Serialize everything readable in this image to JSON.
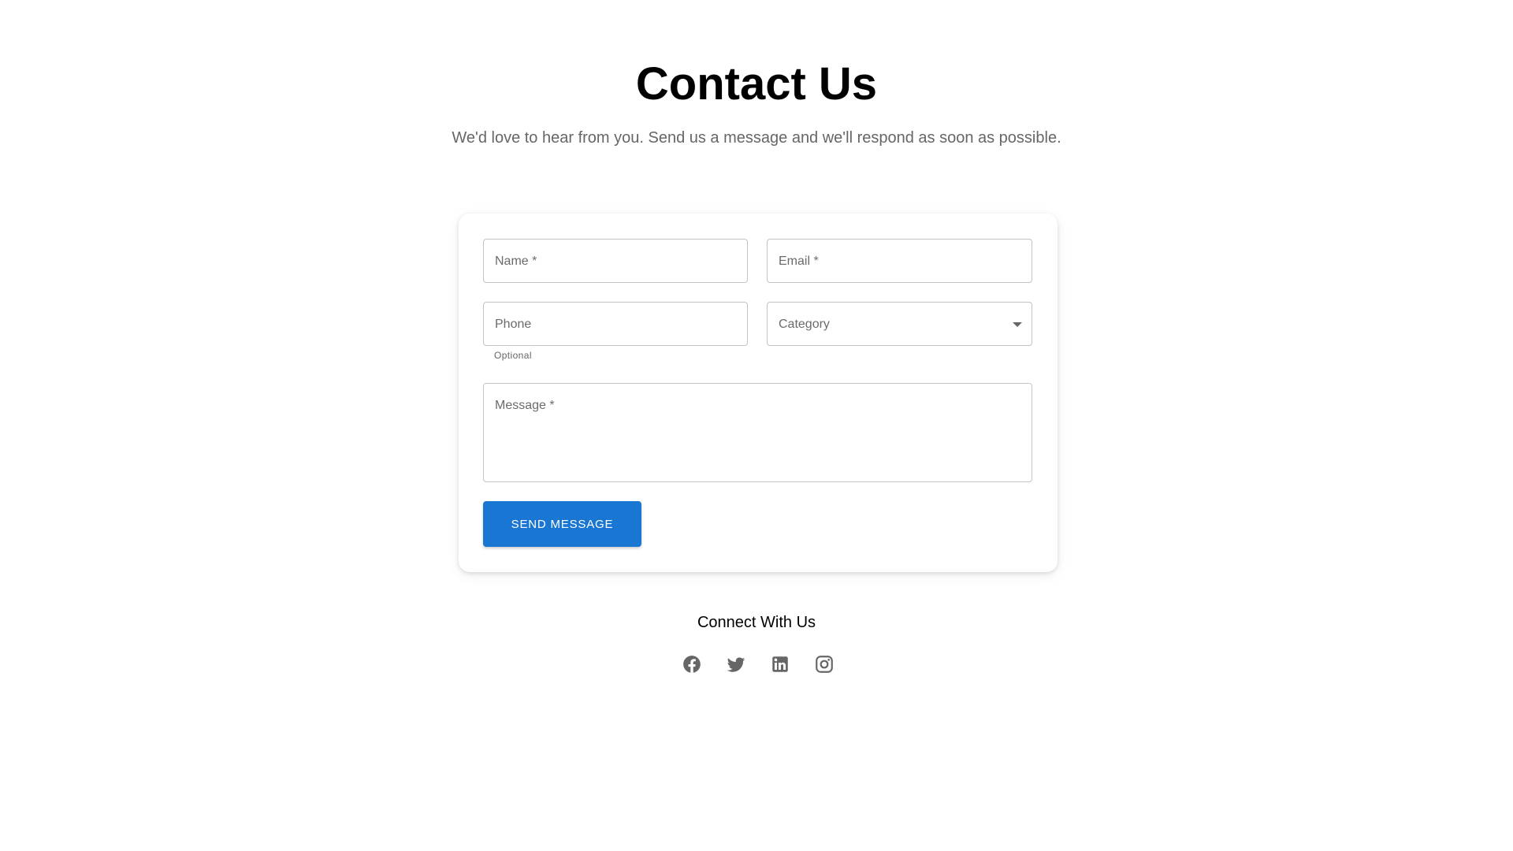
{
  "header": {
    "title": "Contact Us",
    "subtitle": "We'd love to hear from you. Send us a message and we'll respond as soon as possible."
  },
  "form": {
    "name_label": "Name *",
    "email_label": "Email *",
    "phone_label": "Phone",
    "phone_helper": "Optional",
    "category_label": "Category",
    "message_label": "Message *",
    "submit_label": "SEND MESSAGE"
  },
  "social": {
    "heading": "Connect With Us",
    "icons": [
      "facebook-icon",
      "twitter-icon",
      "linkedin-icon",
      "instagram-icon"
    ],
    "icon_color": "#666666"
  },
  "colors": {
    "accent": "#1976d2",
    "field_border": "#c4c4c4",
    "muted_text": "#666666"
  }
}
